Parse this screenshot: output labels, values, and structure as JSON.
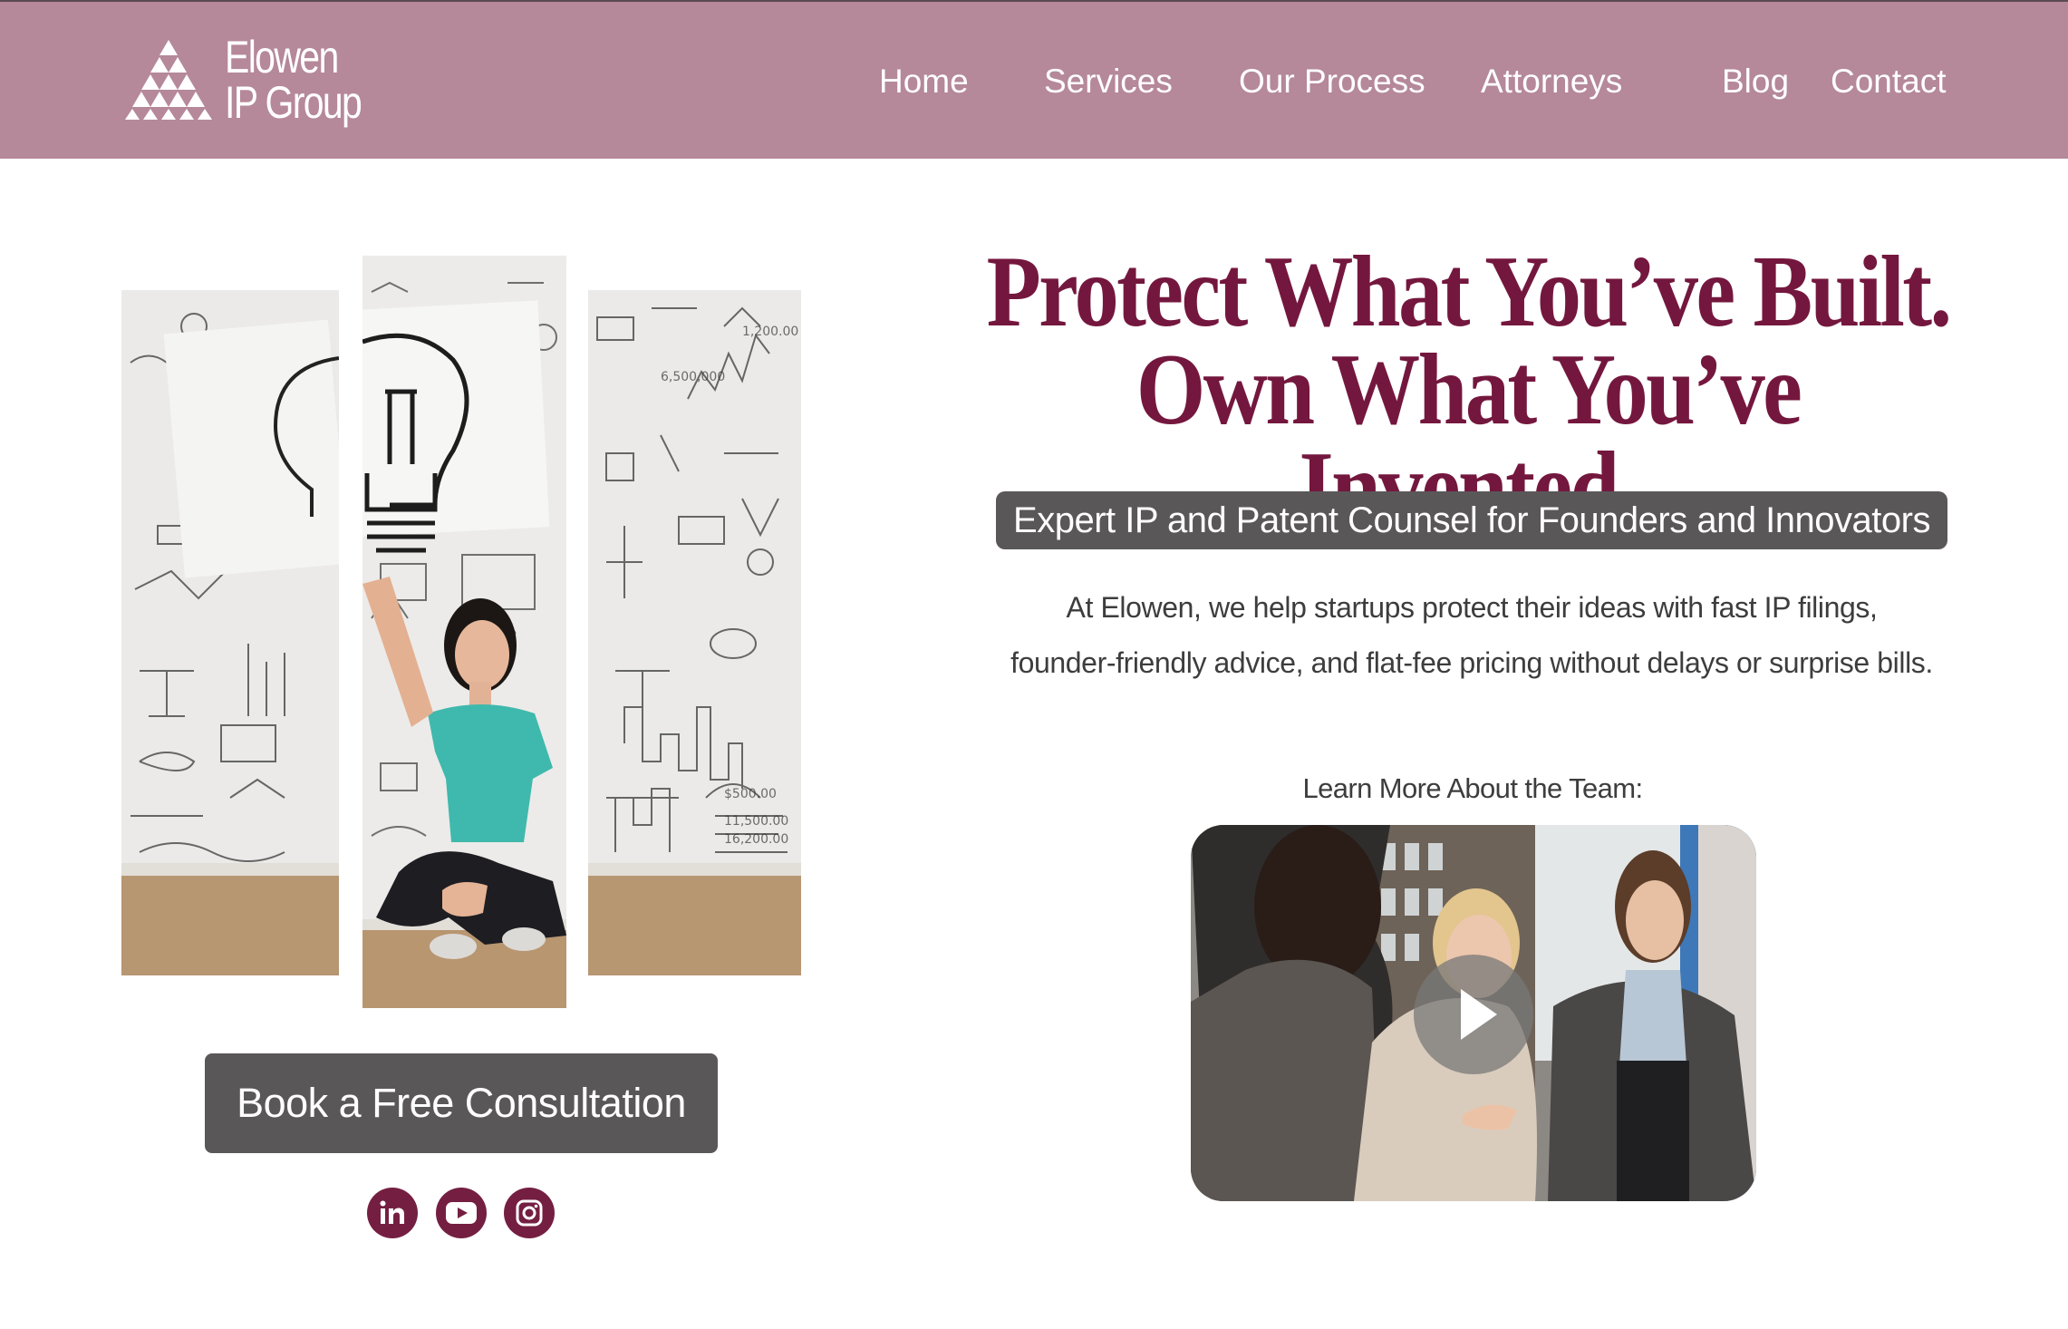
{
  "brand": {
    "name_line1": "Elowen",
    "name_line2": "IP Group",
    "logo_icon": "triangle-pyramid-icon"
  },
  "nav": {
    "items": [
      {
        "label": "Home"
      },
      {
        "label": "Services"
      },
      {
        "label": "Our Process"
      },
      {
        "label": "Attorneys"
      },
      {
        "label": "Blog"
      },
      {
        "label": "Contact"
      }
    ]
  },
  "hero": {
    "headline_line1": "Protect What You’ve Built.",
    "headline_line2": "Own What You’ve Invented.",
    "subheadline": "Expert IP and Patent Counsel for Founders and Innovators",
    "intro_line1": "At Elowen, we help startups protect their ideas with fast IP filings,",
    "intro_line2": "founder-friendly advice, and flat-fee pricing without delays or surprise bills.",
    "cta_label": "Book a Free Consultation",
    "team_label": "Learn More About the Team:"
  },
  "social": [
    {
      "name": "linkedin-icon"
    },
    {
      "name": "youtube-icon"
    },
    {
      "name": "instagram-icon"
    }
  ],
  "colors": {
    "header_bg": "#b5889a",
    "headline": "#74173e",
    "button_bg": "#5a5758",
    "social_bg": "#741f42"
  }
}
